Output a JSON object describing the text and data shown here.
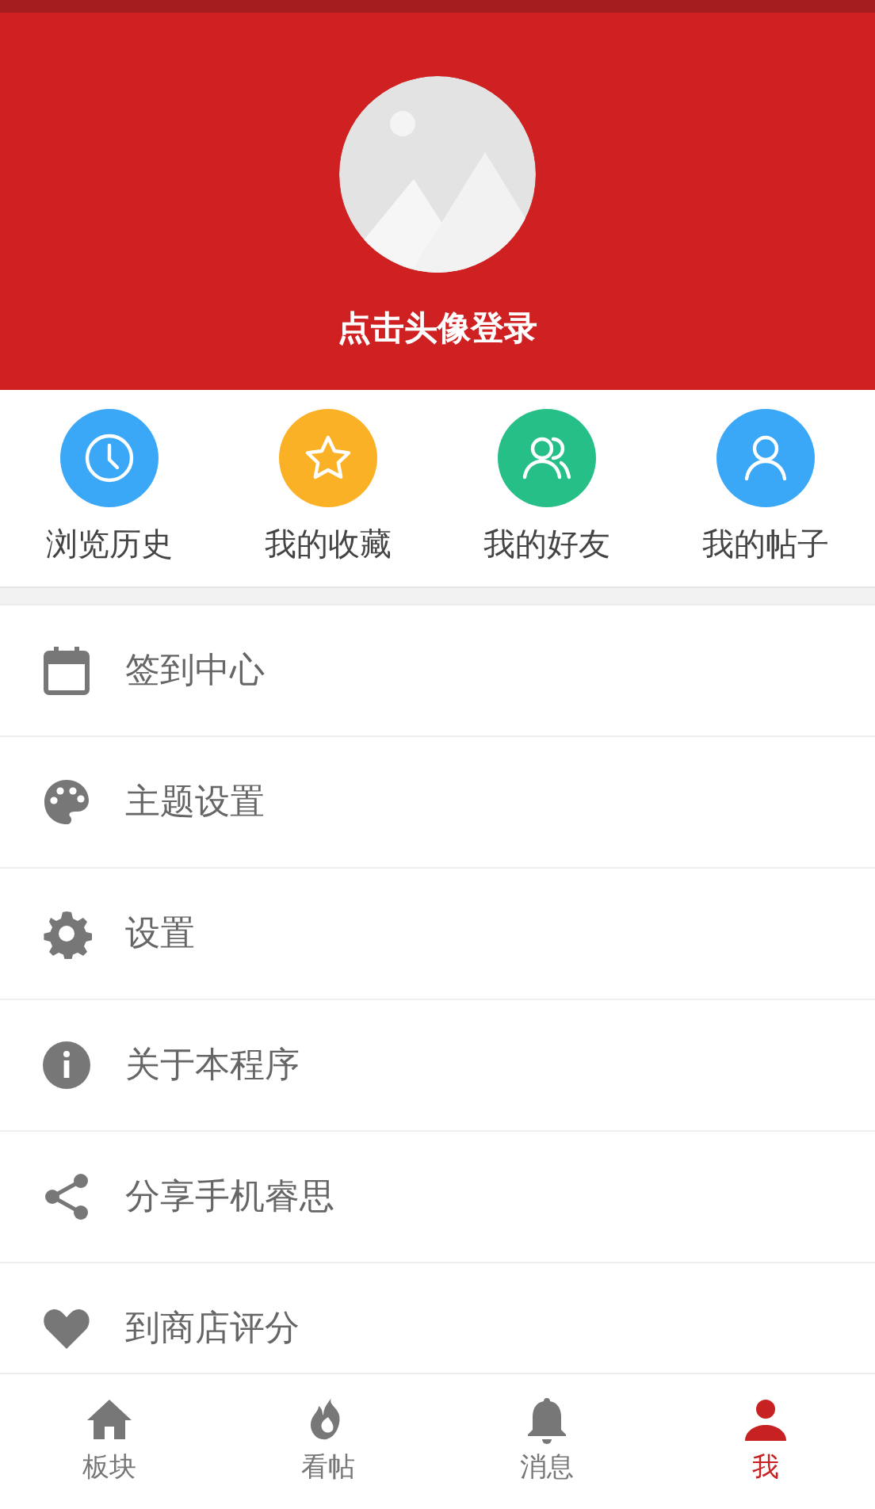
{
  "header": {
    "login_text": "点击头像登录"
  },
  "quick_actions": [
    {
      "label": "浏览历史",
      "color": "#3aa8f6"
    },
    {
      "label": "我的收藏",
      "color": "#fbb126"
    },
    {
      "label": "我的好友",
      "color": "#26bf87"
    },
    {
      "label": "我的帖子",
      "color": "#3aa8f6"
    }
  ],
  "menu": [
    {
      "label": "签到中心"
    },
    {
      "label": "主题设置"
    },
    {
      "label": "设置"
    },
    {
      "label": "关于本程序"
    },
    {
      "label": "分享手机睿思"
    },
    {
      "label": "到商店评分"
    }
  ],
  "tab_bar": [
    {
      "label": "板块",
      "selected": false
    },
    {
      "label": "看帖",
      "selected": false
    },
    {
      "label": "消息",
      "selected": false
    },
    {
      "label": "我",
      "selected": true
    }
  ]
}
